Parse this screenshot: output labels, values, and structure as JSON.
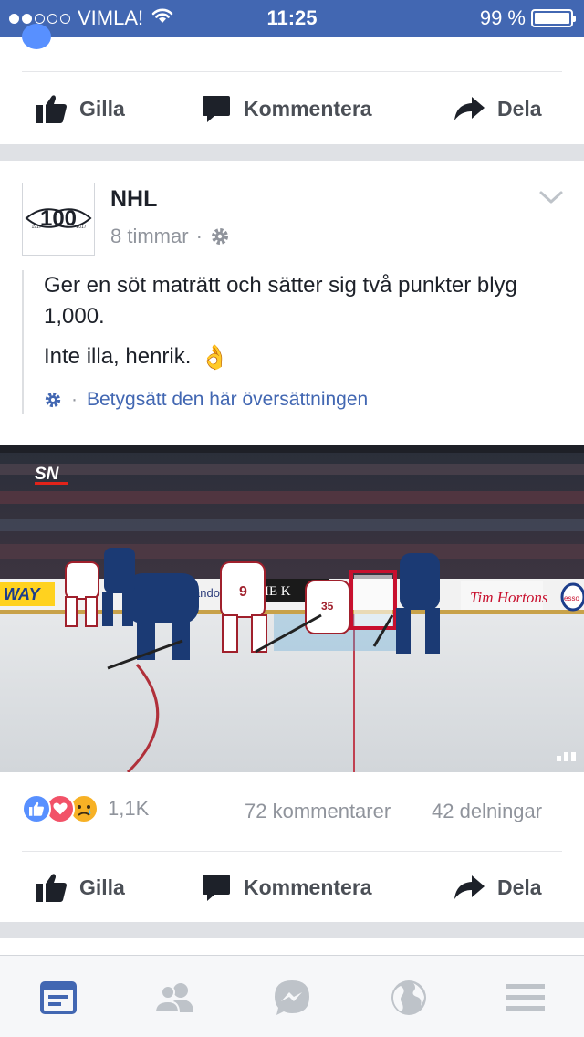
{
  "status_bar": {
    "carrier": "VIMLA!",
    "time": "11:25",
    "battery_percent": "99 %",
    "battery_level": 0.99,
    "signal_dots_filled": 2,
    "signal_dots_total": 5
  },
  "top_card": {
    "like_label": "Gilla",
    "comment_label": "Kommentera",
    "share_label": "Dela"
  },
  "post": {
    "page_name": "NHL",
    "time": "8 timmar",
    "dot_separator": "·",
    "avatar_logo_text": "100",
    "avatar_years": [
      "1917",
      "2017"
    ],
    "text_line1": "Ger en söt maträtt och sätter sig två punkter blyg 1,000.",
    "text_line2": "Inte illa, henrik.",
    "text_line2_emoji": "👌",
    "rate_separator": "·",
    "rate_translation_label": "Betygsätt den här översättningen",
    "image": {
      "network_logo": "SN",
      "jersey_number": "9",
      "goalie_number": "35",
      "board_ad_left": "WAY",
      "board_ad_mid": "HE K",
      "board_ad_mid2": "andon L",
      "board_ad_right": "Tim Hortons",
      "board_ad_far": "esso"
    },
    "reactions": {
      "icons": [
        "like-reaction-icon",
        "love-reaction-icon",
        "sad-reaction-icon"
      ],
      "count": "1,1K"
    },
    "comments_count": "72 kommentarer",
    "shares_count": "42 delningar",
    "like_label": "Gilla",
    "comment_label": "Kommentera",
    "share_label": "Dela"
  },
  "tabbar": {
    "tabs": [
      "news-feed-icon",
      "friends-icon",
      "messenger-icon",
      "globe-icon",
      "menu-icon"
    ],
    "active_tab": "news-feed-icon",
    "active_color": "#4267b2",
    "inactive_color": "#bec3c9"
  },
  "colors": {
    "brand_blue": "#4267b2",
    "link_blue": "#4267b2",
    "text_dark": "#1d2129",
    "text_grey": "#90949c",
    "like_blue": "#5890ff",
    "love_red": "#f25268",
    "sad_yellow": "#f7b125"
  }
}
